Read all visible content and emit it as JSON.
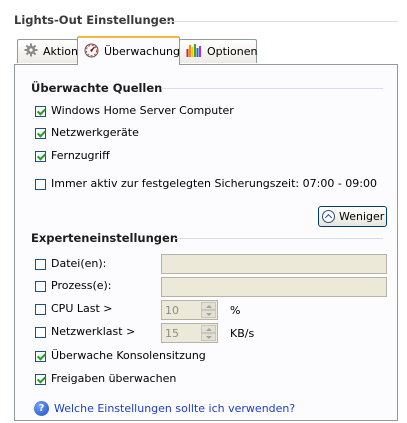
{
  "page": {
    "title": "Lights-Out Einstellungen",
    "accent": "#f7b540"
  },
  "tabs": [
    {
      "label": "Aktion",
      "icon": "gear-icon",
      "active": false
    },
    {
      "label": "Überwachung",
      "icon": "gauge-icon",
      "active": true
    },
    {
      "label": "Optionen",
      "icon": "bar-chart-icon",
      "active": false
    }
  ],
  "monitored": {
    "title": "Überwachte Quellen",
    "items": [
      {
        "label": "Windows Home Server Computer",
        "checked": true
      },
      {
        "label": "Netzwerkgeräte",
        "checked": true
      },
      {
        "label": "Fernzugriff",
        "checked": true
      },
      {
        "label": "Immer aktiv zur festgelegten Sicherungszeit: 07:00 - 09:00",
        "checked": false
      }
    ],
    "less_button": "Weniger"
  },
  "expert": {
    "title": "Experteneinstellungen",
    "files_label": "Datei(en):",
    "process_label": "Prozess(e):",
    "cpu_label": "CPU Last >",
    "cpu_value": "10",
    "cpu_unit": "%",
    "network_label": "Netzwerklast >",
    "network_value": "15",
    "network_unit": "KB/s",
    "console_label": "Überwache Konsolensitzung",
    "shares_label": "Freigaben überwachen"
  },
  "help": {
    "link": "Welche Einstellungen sollte ich verwenden?"
  }
}
